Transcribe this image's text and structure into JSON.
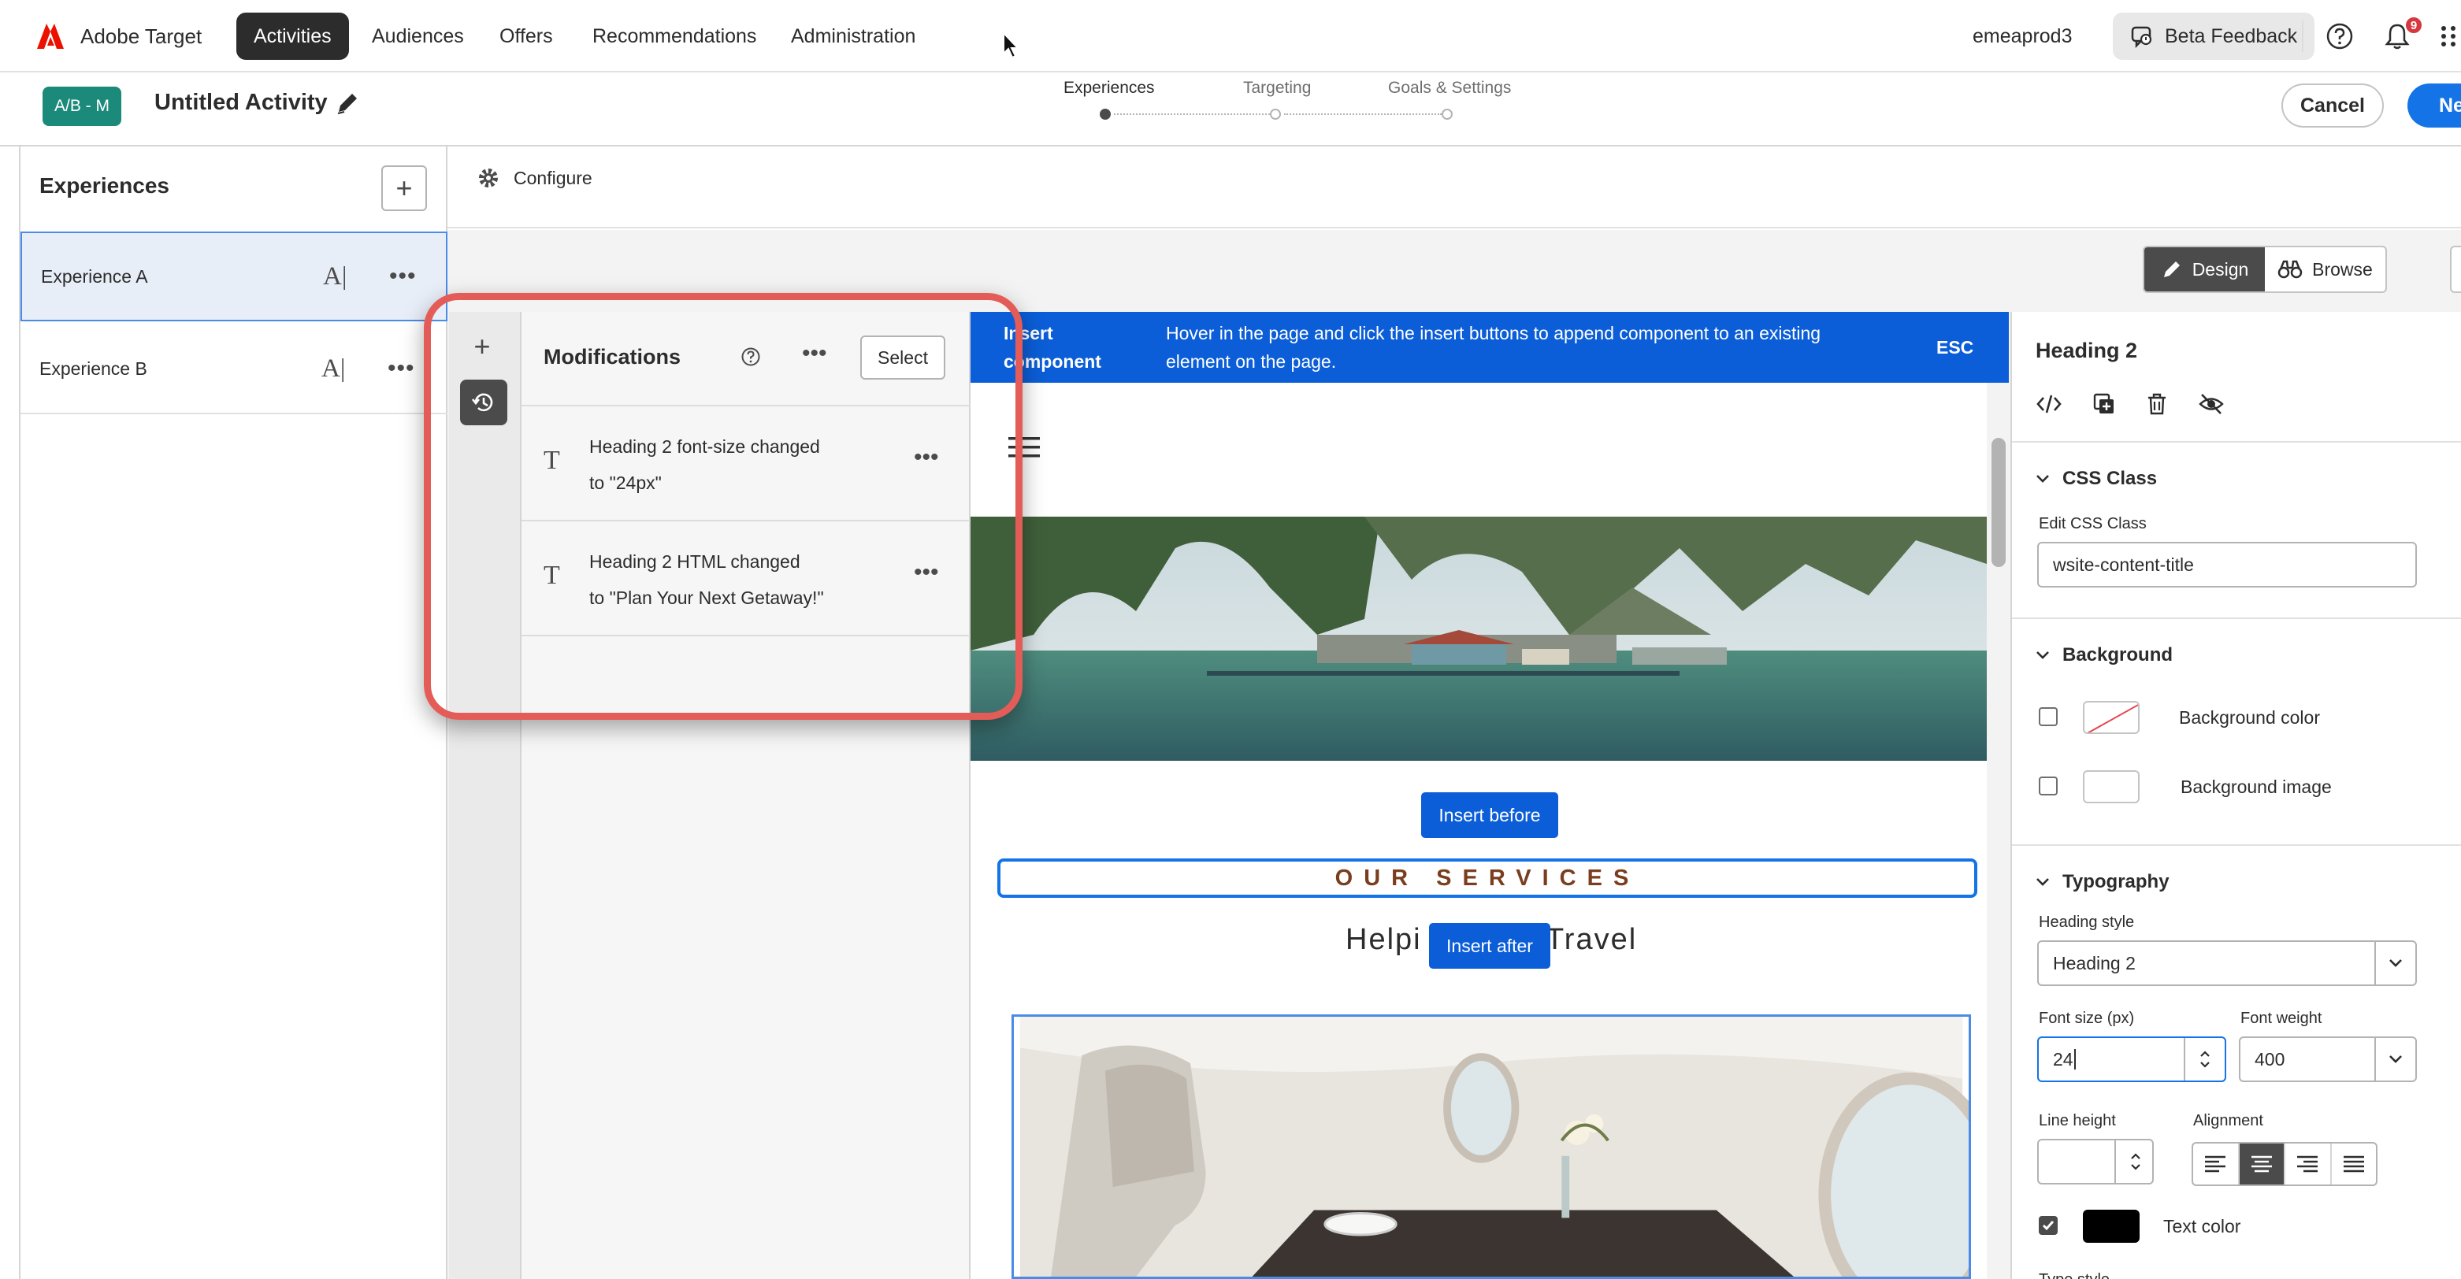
{
  "app": {
    "brand": "Adobe Target",
    "nav": [
      "Activities",
      "Audiences",
      "Offers",
      "Recommendations",
      "Administration"
    ],
    "active_nav": "Activities",
    "org": "emeaprod3",
    "beta_feedback": "Beta Feedback",
    "notification_count": "9"
  },
  "activity": {
    "type_badge": "A/B - M",
    "title": "Untitled Activity",
    "steps": [
      "Experiences",
      "Targeting",
      "Goals & Settings"
    ],
    "current_step": "Experiences",
    "cancel": "Cancel",
    "next": "Ne"
  },
  "experiences": {
    "title": "Experiences",
    "add_symbol": "+",
    "items": [
      {
        "name": "Experience A",
        "ai": "A|",
        "more": "•••"
      },
      {
        "name": "Experience B",
        "ai": "A|",
        "more": "•••"
      }
    ]
  },
  "configure": {
    "label": "Configure"
  },
  "modifications": {
    "title": "Modifications",
    "more": "•••",
    "select": "Select",
    "items": [
      {
        "line1": "Heading 2 font-size changed",
        "line2": "to \"24px\"",
        "more": "•••"
      },
      {
        "line1": "Heading 2 HTML changed",
        "line2": "to \"Plan Your Next Getaway!\"",
        "more": "•••"
      }
    ]
  },
  "banner": {
    "title_line1": "Insert",
    "title_line2": "component",
    "desc_line1": "Hover in the page and click the insert buttons to append component to an existing",
    "desc_line2": "element on the page.",
    "esc": "ESC"
  },
  "preview": {
    "insert_before": "Insert before",
    "insert_after": "Insert after",
    "services": "OUR SERVICES",
    "helping_left": "Helpi",
    "helping_right": "Travel"
  },
  "mode_toggle": {
    "design": "Design",
    "browse": "Browse",
    "active": "Design"
  },
  "properties": {
    "title": "Heading 2",
    "css_class": {
      "section": "CSS Class",
      "label": "Edit CSS Class",
      "value": "wsite-content-title"
    },
    "background": {
      "section": "Background",
      "color_label": "Background color",
      "image_label": "Background image"
    },
    "typography": {
      "section": "Typography",
      "heading_style_label": "Heading style",
      "heading_style_value": "Heading 2",
      "font_size_label": "Font size (px)",
      "font_size_value": "24",
      "font_weight_label": "Font weight",
      "font_weight_value": "400",
      "line_height_label": "Line height",
      "line_height_value": "",
      "alignment_label": "Alignment",
      "alignment_active": "center",
      "text_color_label": "Text color",
      "text_color": "#000000",
      "type_style_label": "Type style"
    }
  },
  "colors": {
    "accent": "#1473e6",
    "banner": "#0b5ed7",
    "ab_badge": "#1c8a7a",
    "highlight_ring": "#e45c57",
    "nav_active": "#2c2c2c"
  }
}
